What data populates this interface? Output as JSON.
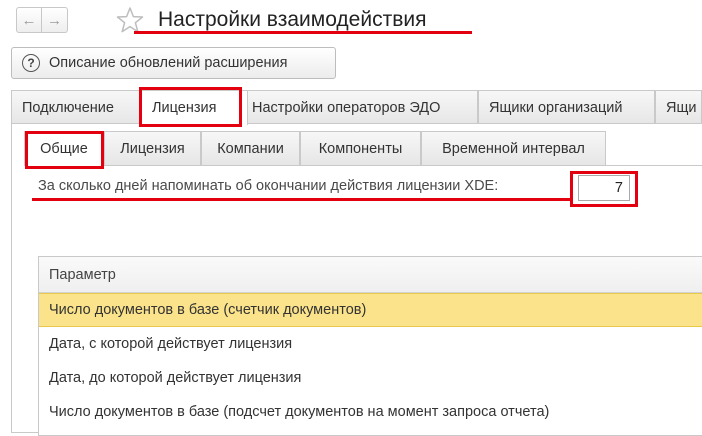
{
  "window": {
    "title": "Настройки взаимодействия",
    "back_icon": "←",
    "forward_icon": "→"
  },
  "toolbar": {
    "description_button": "Описание обновлений расширения",
    "help_icon": "?"
  },
  "outer_tabs": [
    {
      "label": "Подключение",
      "active": false
    },
    {
      "label": "Лицензия",
      "active": true
    },
    {
      "label": "Настройки операторов ЭДО",
      "active": false
    },
    {
      "label": "Ящики организаций",
      "active": false
    },
    {
      "label": "Ящи",
      "active": false
    }
  ],
  "inner_tabs": [
    {
      "label": "Общие",
      "active": true
    },
    {
      "label": "Лицензия",
      "active": false
    },
    {
      "label": "Компании",
      "active": false
    },
    {
      "label": "Компоненты",
      "active": false
    },
    {
      "label": "Временной интервал",
      "active": false
    }
  ],
  "reminder": {
    "label": "За сколько дней напоминать об  окончании действия лицензии XDE:",
    "value": "7"
  },
  "params_table": {
    "header": "Параметр",
    "rows": [
      {
        "label": "Число документов в базе (счетчик документов)",
        "selected": true
      },
      {
        "label": "Дата, с которой действует лицензия",
        "selected": false
      },
      {
        "label": "Дата, до которой действует лицензия",
        "selected": false
      },
      {
        "label": "Число документов в базе (подсчет документов на момент запроса отчета)",
        "selected": false
      }
    ]
  },
  "colors": {
    "annotation": "#e3000f",
    "selected_row": "#fbe38b",
    "border": "#c9c9c9"
  }
}
